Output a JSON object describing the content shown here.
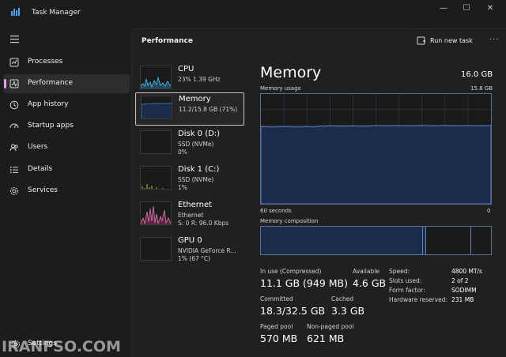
{
  "window": {
    "title": "Task Manager",
    "controls": {
      "minimize": "—",
      "maximize": "☐",
      "close": "✕"
    }
  },
  "nav": {
    "items": [
      {
        "label": "Processes",
        "icon": "processes-icon"
      },
      {
        "label": "Performance",
        "icon": "performance-icon",
        "active": true
      },
      {
        "label": "App history",
        "icon": "app-history-icon"
      },
      {
        "label": "Startup apps",
        "icon": "startup-apps-icon"
      },
      {
        "label": "Users",
        "icon": "users-icon"
      },
      {
        "label": "Details",
        "icon": "details-icon"
      },
      {
        "label": "Services",
        "icon": "services-icon"
      }
    ],
    "settings_label": "Settings"
  },
  "header": {
    "title": "Performance",
    "run_new_task": "Run new task",
    "more": "···"
  },
  "devices": [
    {
      "name": "CPU",
      "sub1": "23%  1.39 GHz",
      "sub2": "",
      "sub3": "",
      "color": "#4fc3f7"
    },
    {
      "name": "Memory",
      "sub1": "11.2/15.8 GB (71%)",
      "sub2": "",
      "sub3": "",
      "color": "#6b8fd6",
      "selected": true
    },
    {
      "name": "Disk 0 (D:)",
      "sub1": "SSD (NVMe)",
      "sub2": "0%",
      "sub3": "",
      "color": "#9acd32"
    },
    {
      "name": "Disk 1 (C:)",
      "sub1": "SSD (NVMe)",
      "sub2": "1%",
      "sub3": "",
      "color": "#9acd32"
    },
    {
      "name": "Ethernet",
      "sub1": "Ethernet",
      "sub2": "S: 0 R: 96.0 Kbps",
      "sub3": "",
      "color": "#e27ab6"
    },
    {
      "name": "GPU 0",
      "sub1": "NVIDIA GeForce R...",
      "sub2": "1% (67 °C)",
      "sub3": "",
      "color": "#b8a0e0"
    }
  ],
  "memory": {
    "title": "Memory",
    "total": "16.0 GB",
    "usage_label": "Memory usage",
    "usage_max": "15.8 GB",
    "time_label": "60 seconds",
    "time_end": "0",
    "usage_fraction": 0.71,
    "composition_label": "Memory composition",
    "stats": {
      "in_use_label": "In use (Compressed)",
      "in_use_value": "11.1 GB (949 MB)",
      "available_label": "Available",
      "available_value": "4.6 GB",
      "committed_label": "Committed",
      "committed_value": "18.3/32.5 GB",
      "cached_label": "Cached",
      "cached_value": "3.3 GB",
      "paged_label": "Paged pool",
      "paged_value": "570 MB",
      "nonpaged_label": "Non-paged pool",
      "nonpaged_value": "621 MB"
    },
    "specs": [
      {
        "key": "Speed:",
        "value": "4800 MT/s"
      },
      {
        "key": "Slots used:",
        "value": "2 of 2"
      },
      {
        "key": "Form factor:",
        "value": "SODIMM"
      },
      {
        "key": "Hardware reserved:",
        "value": "231 MB"
      }
    ]
  },
  "colors": {
    "accent": "#e39cff",
    "memory_fill": "#1b2c4a",
    "memory_line": "#5a7fc2"
  },
  "watermark": "IRANFSO.COM"
}
